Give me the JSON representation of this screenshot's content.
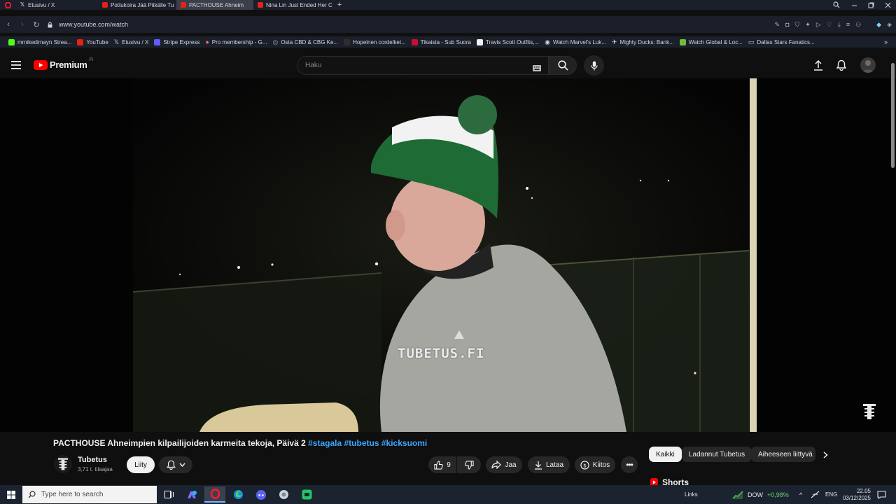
{
  "browser": {
    "tabs": [
      {
        "label": "Etusivu / X",
        "icon": "x-icon",
        "active": false
      },
      {
        "label": "Pottukoira Jää Pitkälle Tu",
        "icon": "youtube-icon",
        "active": false
      },
      {
        "label": "PACTHOUSE Ahneim",
        "icon": "youtube-icon",
        "active": true
      },
      {
        "label": "Nina Lin Just Ended Her C",
        "icon": "youtube-icon",
        "active": false
      }
    ],
    "new_tab_label": "+",
    "url": "www.youtube.com/watch",
    "bookmarks": [
      {
        "label": "mmikedimayn Strea..."
      },
      {
        "label": "YouTube"
      },
      {
        "label": "Etusivu / X"
      },
      {
        "label": "Stripe Express"
      },
      {
        "label": "Pro membership - G..."
      },
      {
        "label": "Osta CBD & CBG Ke..."
      },
      {
        "label": "Hopeinen cordelket..."
      },
      {
        "label": "Tikaista - Sub Suora"
      },
      {
        "label": "Travis Scott Outfits,..."
      },
      {
        "label": "Watch Marvel's Luk..."
      },
      {
        "label": "Mighty Ducks: Bank..."
      },
      {
        "label": "Watch Global & Loc..."
      },
      {
        "label": "Dallas Stars Fanatics..."
      }
    ]
  },
  "youtube": {
    "logo_text": "Premium",
    "logo_region": "FI",
    "search_placeholder": "Haku",
    "watermark": "TUBETUS.FI",
    "video": {
      "title": "PACTHOUSE Ahneimpien kilpailijoiden karmeita tekoja, Päivä 2",
      "hashtags": [
        "#stagala",
        "#tubetus",
        "#kicksuomi"
      ],
      "channel_name": "Tubetus",
      "subscribers": "3,71 t. tilaajaa",
      "join_label": "Liity",
      "likes": "9",
      "share_label": "Jaa",
      "download_label": "Lataa",
      "thanks_label": "Kiitos"
    },
    "chips": [
      "Kaikki",
      "Ladannut Tubetus",
      "Aiheeseen liittyvä"
    ],
    "shorts_label": "Shorts"
  },
  "taskbar": {
    "search_placeholder": "Type here to search",
    "stock_name": "DOW",
    "stock_change": "+0,98%",
    "links_label": "Links",
    "language": "ENG",
    "time": "22.05",
    "date": "03/12/2025"
  }
}
